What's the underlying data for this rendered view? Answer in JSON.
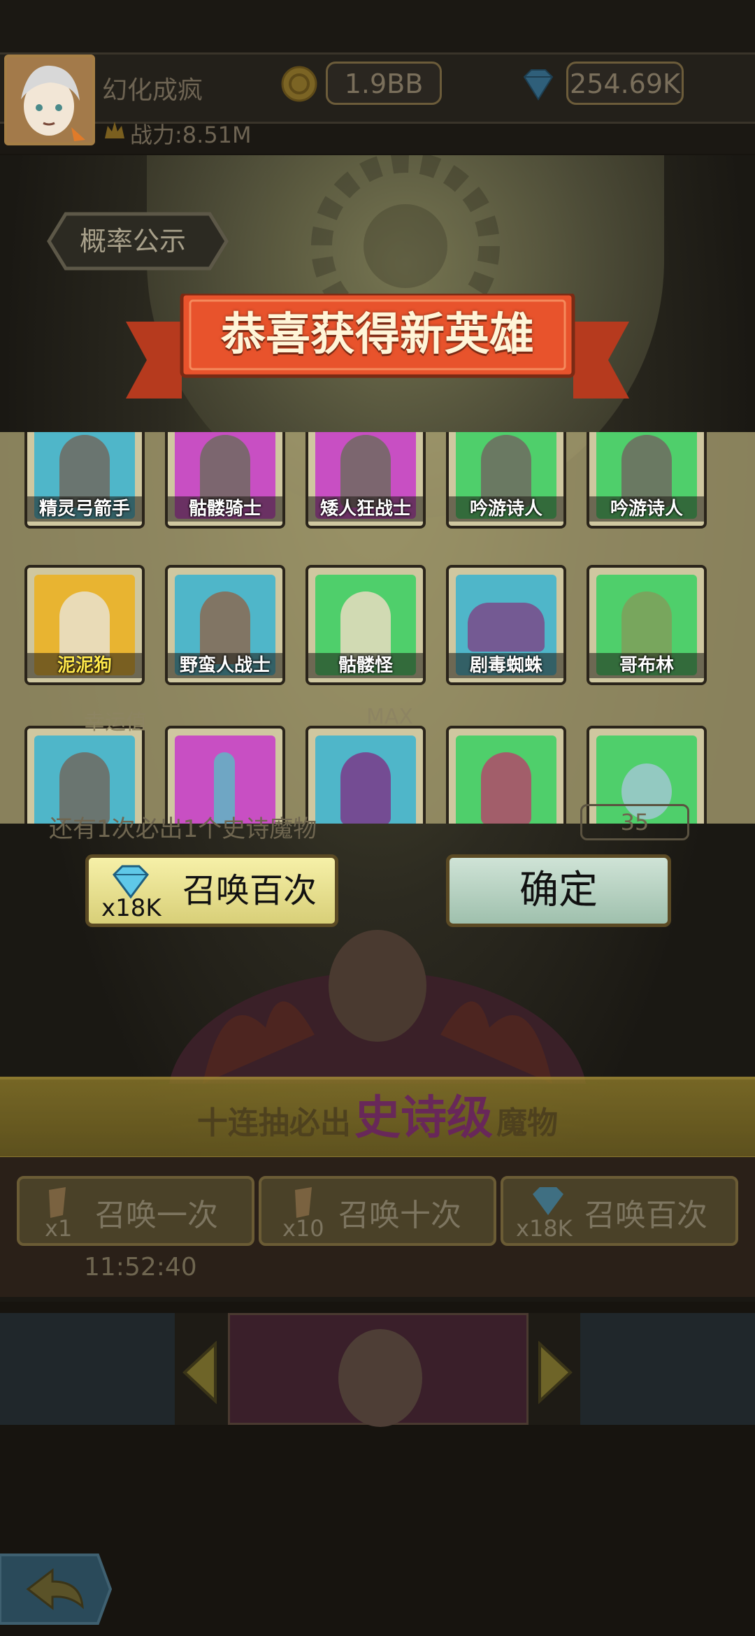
{
  "player": {
    "name": "幻化成疯",
    "power": "战力:8.51M",
    "gold": "1.9BB",
    "gems": "254.69K"
  },
  "probability_button": "概率公示",
  "reward_banner": "恭喜获得新英雄",
  "heroes_row1": [
    {
      "name": "精灵弓箭手",
      "bg": "blue"
    },
    {
      "name": "骷髅骑士",
      "bg": "purple"
    },
    {
      "name": "矮人狂战士",
      "bg": "purple"
    },
    {
      "name": "吟游诗人",
      "bg": "green"
    },
    {
      "name": "吟游诗人",
      "bg": "green"
    }
  ],
  "heroes_row2": [
    {
      "name": "泥泥狗",
      "bg": "gold",
      "highlight": true
    },
    {
      "name": "野蛮人战士",
      "bg": "blue"
    },
    {
      "name": "骷髅怪",
      "bg": "green"
    },
    {
      "name": "剧毒蜘蛛",
      "bg": "blue"
    },
    {
      "name": "哥布林",
      "bg": "green"
    }
  ],
  "heroes_row3": [
    {
      "bg": "blue"
    },
    {
      "bg": "purple"
    },
    {
      "bg": "blue"
    },
    {
      "bg": "green"
    },
    {
      "bg": "green"
    }
  ],
  "background_texts": {
    "luck_label": "幸运值",
    "luck_max": "MAX",
    "guarantee": "还有1次必出1个史诗魔物",
    "scroll_count": "35",
    "epic_banner_prefix": "十连抽必出",
    "epic_banner_highlight": "史诗级",
    "epic_banner_suffix": "魔物"
  },
  "dialog_buttons": {
    "summon_100": "召唤百次",
    "summon_100_cost": "x18K",
    "confirm": "确定"
  },
  "summon_buttons": [
    {
      "label": "召唤一次",
      "cost": "x1"
    },
    {
      "label": "召唤十次",
      "cost": "x10"
    },
    {
      "label": "召唤百次",
      "cost": "x18K"
    }
  ],
  "timer": "11:52:40",
  "colors": {
    "banner_red": "#e8532c",
    "banner_text": "#fff5d8",
    "gold_text": "#ffe84a"
  }
}
